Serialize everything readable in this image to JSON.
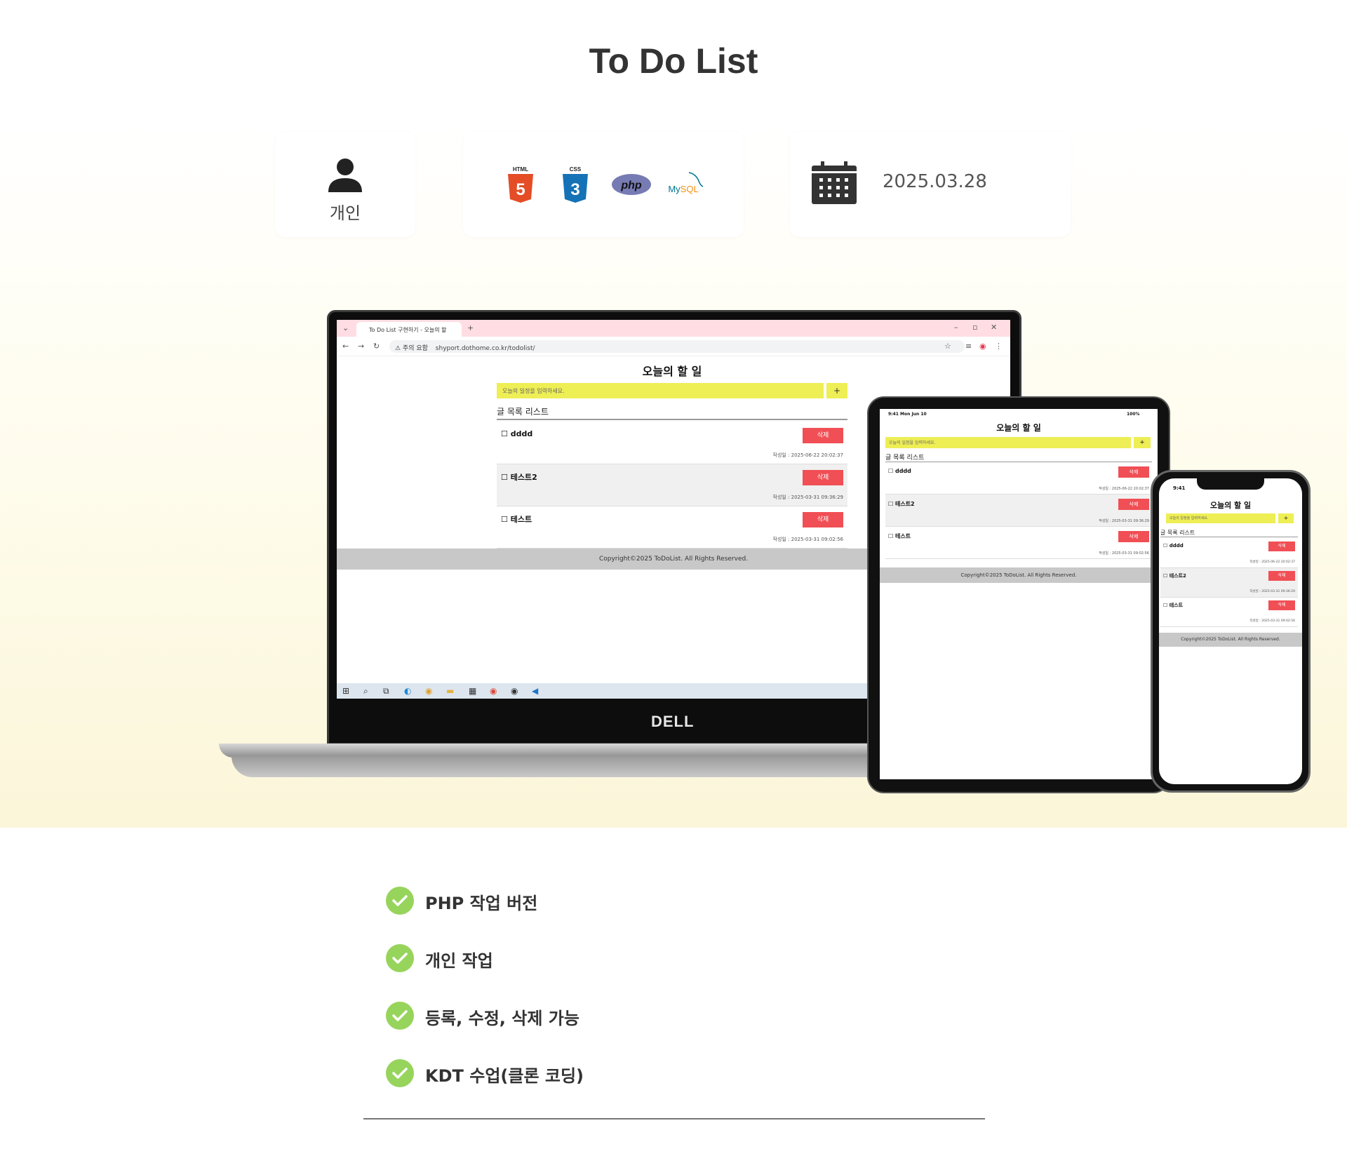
{
  "page": {
    "title": "To Do List"
  },
  "info": {
    "person": {
      "label": "개인",
      "icon": "person-icon"
    },
    "tech": [
      {
        "name": "html5-logo",
        "text": "HTML",
        "color": "#e44d26"
      },
      {
        "name": "css3-logo",
        "text": "CSS",
        "color": "#1572b6"
      },
      {
        "name": "php-logo",
        "text": "php",
        "color": "#777bb3"
      },
      {
        "name": "mysql-logo",
        "text": "MySQL",
        "color": "#00758f"
      }
    ],
    "date": {
      "text": "2025.03.28",
      "icon": "calendar-icon"
    }
  },
  "browser": {
    "tab_title": "To Do List 구현하기 - 오늘의 할",
    "new_tab": "+",
    "address_warning": "⚠ 주의 요함",
    "address": "shyport.dothome.co.kr/todolist/"
  },
  "app": {
    "title": "오늘의 할 일",
    "input_placeholder": "오늘의 일정을 입력하세요.",
    "add_label": "+",
    "list_title": "글 목록 리스트",
    "delete_label": "삭제",
    "items": [
      {
        "text": "dddd",
        "date": "작성일 : 2025-06-22 20:02:37"
      },
      {
        "text": "테스트2",
        "date": "작성일 : 2025-03-31 09:36:29"
      },
      {
        "text": "테스트",
        "date": "작성일 : 2025-03-31 09:02:56"
      }
    ],
    "footer": "Copyright©2025 ToDoList. All Rights Reserved."
  },
  "devices": {
    "laptop_brand": "DELL",
    "tablet_status": "9:41  Mon Jun 10",
    "tablet_battery": "100%",
    "phone_status": "9:41"
  },
  "features": [
    {
      "text": "PHP 작업 버전"
    },
    {
      "text": "개인 작업"
    },
    {
      "text": "등록, 수정, 삭제 가능"
    },
    {
      "text": "KDT 수업(클론 코딩)"
    }
  ],
  "colors": {
    "accent_check": "#97d45c",
    "delete": "#f04f55",
    "input": "#eeee55"
  }
}
